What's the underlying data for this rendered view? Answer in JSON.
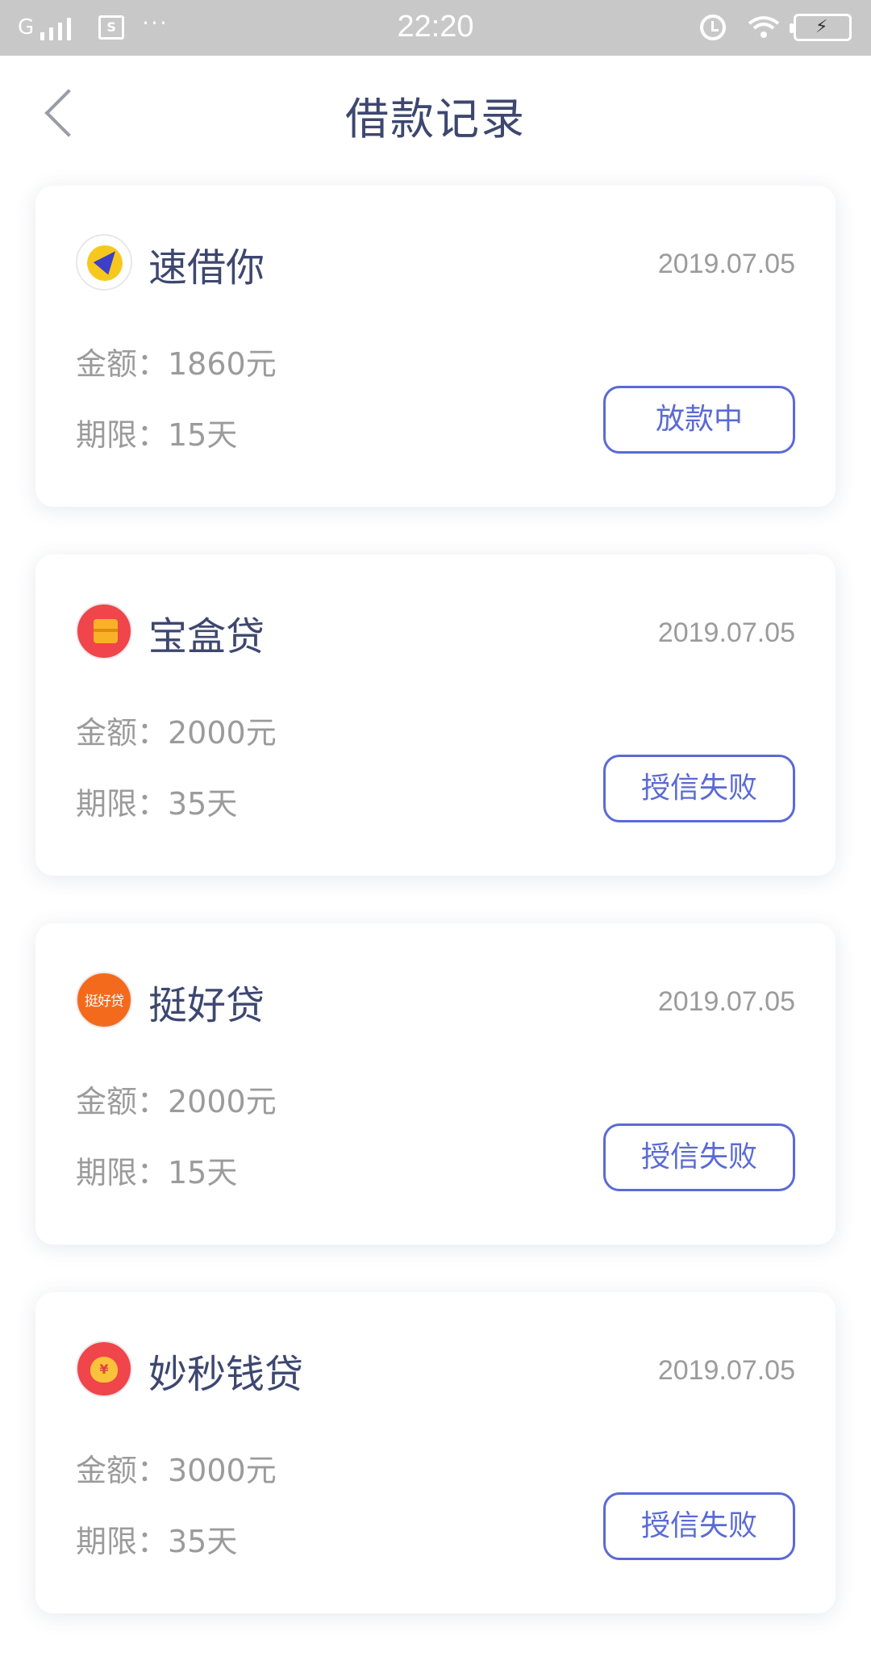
{
  "status_bar": {
    "network": "G",
    "time": "22:20",
    "sim_label": "S",
    "more": "···",
    "battery_symbol": "⚡"
  },
  "nav": {
    "title": "借款记录"
  },
  "records": [
    {
      "name": "速借你",
      "date": "2019.07.05",
      "amount": "金额：1860元",
      "term": "期限：15天",
      "status": "放款中",
      "logo": "sujieni-logo"
    },
    {
      "name": "宝盒贷",
      "date": "2019.07.05",
      "amount": "金额：2000元",
      "term": "期限：35天",
      "status": "授信失败",
      "logo": "baohedai-logo"
    },
    {
      "name": "挺好贷",
      "date": "2019.07.05",
      "amount": "金额：2000元",
      "term": "期限：15天",
      "status": "授信失败",
      "logo": "tinghaodai-logo",
      "logo_text": "挺好贷"
    },
    {
      "name": "妙秒钱贷",
      "date": "2019.07.05",
      "amount": "金额：3000元",
      "term": "期限：35天",
      "status": "授信失败",
      "logo": "miaomiaoqiandai-logo",
      "logo_text": "¥"
    }
  ],
  "colors": {
    "title": "#3d4770",
    "accent": "#5a6ad6",
    "muted": "#9b9b9b",
    "status_bar": "#c8c8c8"
  }
}
